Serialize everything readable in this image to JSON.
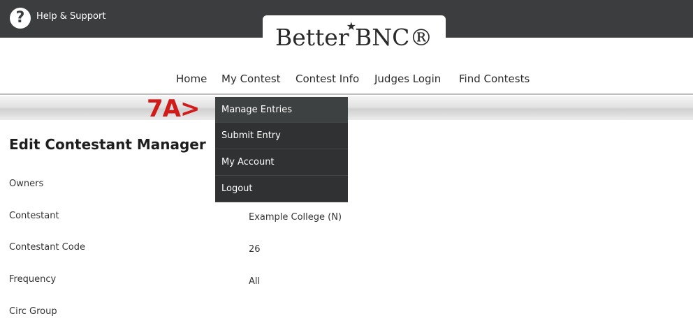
{
  "topbar": {
    "help_label": "Help & Support",
    "help_glyph": "?"
  },
  "logo": {
    "text_left": "Better",
    "text_right": "BNC",
    "registered": "®",
    "star_glyph": "★"
  },
  "nav": {
    "items": [
      "Home",
      "My Contest",
      "Contest Info",
      "Judges Login",
      "Find Contests"
    ]
  },
  "callout": {
    "label": "7A>"
  },
  "dropdown": {
    "items": [
      "Manage Entries",
      "Submit Entry",
      "My Account",
      "Logout"
    ]
  },
  "page": {
    "title": "Edit Contestant Manager",
    "fields": [
      {
        "label": "Owners",
        "value": ""
      },
      {
        "label": "Contestant",
        "value": "Example College (N)"
      },
      {
        "label": "Contestant Code",
        "value": "26"
      },
      {
        "label": "Frequency",
        "value": "All"
      },
      {
        "label": "Circ Group",
        "value": ""
      }
    ]
  },
  "colors": {
    "topbar": "#3b3d3e",
    "dropdown": "#2f3132",
    "callout": "#d11a1a"
  }
}
